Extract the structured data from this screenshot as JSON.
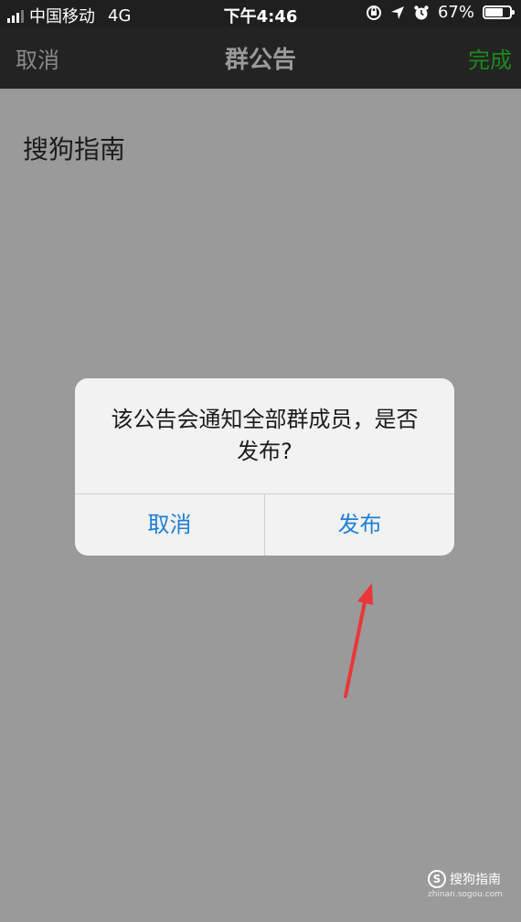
{
  "status_bar": {
    "carrier": "中国移动",
    "network": "4G",
    "time": "下午4:46",
    "battery_percent": "67%",
    "battery_level": 0.67
  },
  "nav": {
    "cancel_label": "取消",
    "title": "群公告",
    "done_label": "完成",
    "done_color": "#1b8a1b"
  },
  "editor": {
    "text": "搜狗指南"
  },
  "dialog": {
    "message": "该公告会通知全部群成员，是否发布?",
    "cancel_label": "取消",
    "publish_label": "发布",
    "button_color": "#1e7fd4"
  },
  "annotation": {
    "arrow_color": "#e8373a"
  },
  "watermark": {
    "logo_text": "S",
    "name": "搜狗指南",
    "url": "zhinan.sogou.com"
  }
}
